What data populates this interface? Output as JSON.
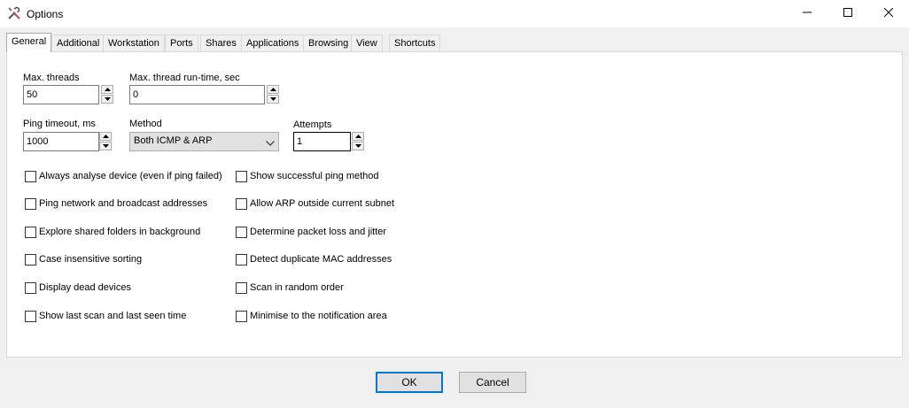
{
  "window": {
    "title": "Options",
    "icon": "tools-icon",
    "controls": {
      "minimize": "minimize-icon",
      "maximize": "maximize-icon",
      "close": "close-icon"
    }
  },
  "tabs": [
    {
      "label": "General",
      "active": true
    },
    {
      "label": "Additional"
    },
    {
      "label": "Workstation"
    },
    {
      "label": "Ports"
    },
    {
      "label": "Shares"
    },
    {
      "label": "Applications"
    },
    {
      "label": "Browsing"
    },
    {
      "label": "View"
    },
    {
      "label": "Shortcuts"
    }
  ],
  "general": {
    "max_threads": {
      "label": "Max. threads",
      "value": "50"
    },
    "max_runtime": {
      "label": "Max. thread run-time, sec",
      "value": "0"
    },
    "ping_timeout": {
      "label": "Ping timeout, ms",
      "value": "1000"
    },
    "method": {
      "label": "Method",
      "value": "Both ICMP & ARP"
    },
    "attempts": {
      "label": "Attempts",
      "value": "1"
    },
    "checkboxes_left": [
      {
        "label": "Always analyse device (even if ping failed)",
        "checked": false
      },
      {
        "label": "Ping network and broadcast addresses",
        "checked": false
      },
      {
        "label": "Explore shared folders in background",
        "checked": false
      },
      {
        "label": "Case insensitive sorting",
        "checked": false
      },
      {
        "label": "Display dead devices",
        "checked": false
      },
      {
        "label": "Show last scan and last seen time",
        "checked": false
      }
    ],
    "checkboxes_right": [
      {
        "label": "Show successful ping method",
        "checked": false
      },
      {
        "label": "Allow ARP outside current subnet",
        "checked": false
      },
      {
        "label": "Determine packet loss and jitter",
        "checked": false
      },
      {
        "label": "Detect duplicate MAC addresses",
        "checked": false
      },
      {
        "label": "Scan in random order",
        "checked": false
      },
      {
        "label": "Minimise to the notification area",
        "checked": false
      }
    ]
  },
  "buttons": {
    "ok": "OK",
    "cancel": "Cancel"
  },
  "colors": {
    "accent": "#0078d7",
    "panel": "#ffffff",
    "dialog": "#f0f0f0"
  }
}
